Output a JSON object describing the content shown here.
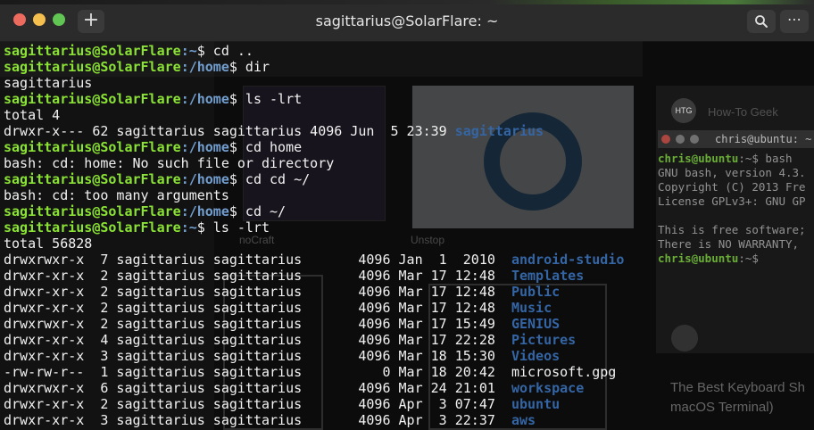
{
  "window": {
    "title": "sagittarius@SolarFlare: ~",
    "new_tab_symbol": "+",
    "menu_symbol": "⋯"
  },
  "colors": {
    "prompt_user": "#8ae234",
    "prompt_path": "#729fcf",
    "dir_listing": "#3465a4",
    "titlebar": "#2b2b2b",
    "background": "#0c0c0c"
  },
  "icons": [
    "close-dot",
    "minimize-dot",
    "maximize-dot",
    "plus-icon",
    "search-icon",
    "ellipsis-icon"
  ],
  "terminal": {
    "user_host": "sagittarius@SolarFlare",
    "lines": [
      {
        "path": ":~",
        "cmd": "$ cd .."
      },
      {
        "path": ":/home",
        "cmd": "$ dir"
      },
      {
        "out": "sagittarius"
      },
      {
        "path": ":/home",
        "cmd": "$ ls -lrt"
      },
      {
        "out": "total 4"
      },
      {
        "out": "drwxr-x--- 62 sagittarius sagittarius 4096 Jun  5 23:39 ",
        "dir": "sagittarius"
      },
      {
        "path": ":/home",
        "cmd": "$ cd home"
      },
      {
        "out": "bash: cd: home: No such file or directory"
      },
      {
        "path": ":/home",
        "cmd": "$ cd cd ~/"
      },
      {
        "out": "bash: cd: too many arguments"
      },
      {
        "path": ":/home",
        "cmd": "$ cd ~/"
      },
      {
        "path": ":~",
        "cmd": "$ ls -lrt"
      },
      {
        "out": "total 56828"
      },
      {
        "out": "drwxrwxr-x  7 sagittarius sagittarius       4096 Jan  1  2010  ",
        "dir": "android-studio"
      },
      {
        "out": "drwxr-xr-x  2 sagittarius sagittarius       4096 Mar 17 12:48  ",
        "dir": "Templates"
      },
      {
        "out": "drwxr-xr-x  2 sagittarius sagittarius       4096 Mar 17 12:48  ",
        "dir": "Public"
      },
      {
        "out": "drwxr-xr-x  2 sagittarius sagittarius       4096 Mar 17 12:48  ",
        "dir": "Music"
      },
      {
        "out": "drwxrwxr-x  2 sagittarius sagittarius       4096 Mar 17 15:49  ",
        "dir": "GENIUS"
      },
      {
        "out": "drwxr-xr-x  4 sagittarius sagittarius       4096 Mar 17 22:28  ",
        "dir": "Pictures"
      },
      {
        "out": "drwxr-xr-x  3 sagittarius sagittarius       4096 Mar 18 15:30  ",
        "dir": "Videos"
      },
      {
        "out": "-rw-rw-r--  1 sagittarius sagittarius          0 Mar 18 20:42  microsoft.gpg"
      },
      {
        "out": "drwxrwxr-x  6 sagittarius sagittarius       4096 Mar 24 21:01  ",
        "dir": "workspace"
      },
      {
        "out": "drwxr-xr-x  2 sagittarius sagittarius       4096 Apr  3 07:47  ",
        "dir": "ubuntu"
      },
      {
        "out": "drwxr-xr-x  3 sagittarius sagittarius       4096 Apr  3 22:37  ",
        "dir": "aws"
      }
    ]
  },
  "background_ghost": {
    "site_name": "How-To Geek",
    "site_logo": "HTG",
    "caption_1": "noCraft",
    "caption_2": "Unstop",
    "article_title_1": "The Best Keyboard Sh",
    "article_title_2": "macOS Terminal)",
    "mini_terminal": {
      "title": "chris@ubuntu: ~",
      "lines": [
        {
          "user": "chris@ubuntu",
          "rest": ":~$ bash"
        },
        {
          "text": "GNU bash, version 4.3."
        },
        {
          "text": "Copyright (C) 2013 Fre"
        },
        {
          "text": "License GPLv3+: GNU GP"
        },
        {
          "text": ""
        },
        {
          "text": "This is free software;"
        },
        {
          "text": "There is NO WARRANTY,"
        },
        {
          "user": "chris@ubuntu",
          "rest": ":~$"
        }
      ]
    }
  }
}
